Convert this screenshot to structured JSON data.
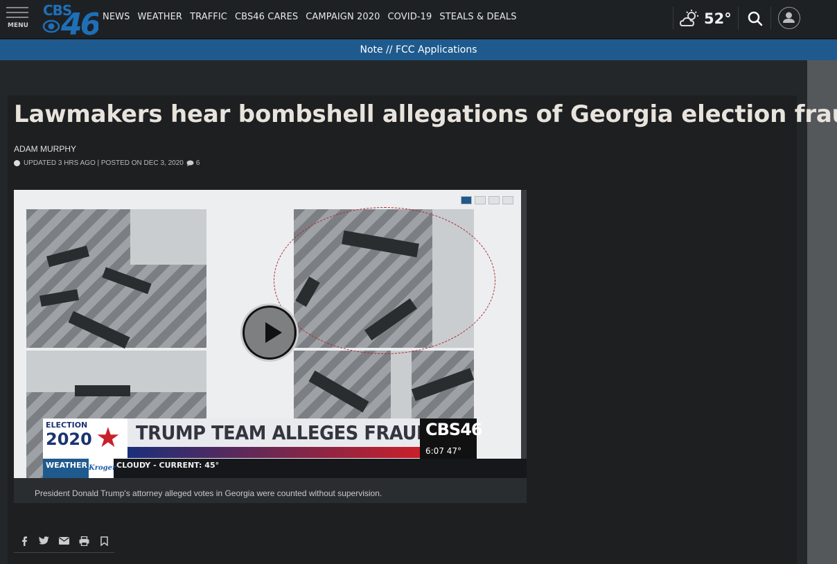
{
  "header": {
    "menu_label": "MENU",
    "nav": [
      "NEWS",
      "WEATHER",
      "TRAFFIC",
      "CBS46 CARES",
      "CAMPAIGN 2020",
      "COVID-19",
      "STEALS & DEALS"
    ],
    "temperature": "52°",
    "weather_icon": "partly-cloudy-icon"
  },
  "banner": {
    "text": "Note // FCC Applications"
  },
  "article": {
    "headline": "Lawmakers hear bombshell allegations of Georgia election fraud",
    "author": "ADAM MURPHY",
    "meta": "UPDATED 3 HRS AGO | POSTED ON DEC 3, 2020",
    "comment_count": "6"
  },
  "video": {
    "election_label": "ELECTION",
    "election_year": "2020",
    "lower_third_headline": "TRUMP TEAM ALLEGES FRAUD",
    "station_logo": "CBS46",
    "station_time": "6:07  47°",
    "ticker_label": "WEATHER",
    "ticker_sponsor": "Kroger",
    "ticker_text": "CLOUDY  -  CURRENT: 45°",
    "caption": "President Donald Trump's attorney alleged votes in Georgia were counted without supervision."
  },
  "share_icons": [
    "facebook-icon",
    "twitter-icon",
    "email-icon",
    "print-icon",
    "bookmark-icon"
  ],
  "colors": {
    "brand_blue": "#1e5a8e",
    "background": "#242729",
    "card": "#1d1f21",
    "accent_red": "#c8202a"
  }
}
